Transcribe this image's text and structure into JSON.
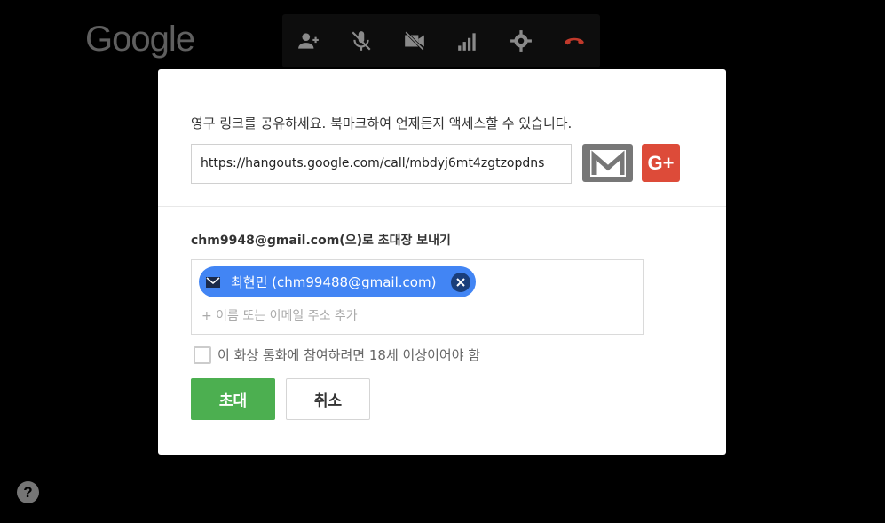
{
  "logo": {
    "text": "Google"
  },
  "callbar": {
    "icons": [
      "add-person-icon",
      "mic-off-icon",
      "video-off-icon",
      "signal-icon",
      "gear-icon",
      "hangup-icon"
    ],
    "hangup_color": "#c0392b"
  },
  "share": {
    "text": "영구 링크를 공유하세요. 북마크하여 언제든지 액세스할 수 있습니다.",
    "link": "https://hangouts.google.com/call/mbdyj6mt4zgtzopdns",
    "gplus_label": "G+"
  },
  "invite": {
    "title": "chm9948@gmail.com(으)로 초대장 보내기",
    "chip_label": "최현민 (chm99488@gmail.com)",
    "placeholder": "+ 이름 또는 이메일 주소 추가",
    "age_label": "이 화상 통화에 참여하려면 18세 이상이어야 함",
    "invite_button": "초대",
    "cancel_button": "취소"
  },
  "help": {
    "label": "?"
  },
  "colors": {
    "invite_green": "#4caf50",
    "chip_blue": "#4285f4",
    "gplus_red": "#dd4b39",
    "gmail_gray": "#777777"
  }
}
